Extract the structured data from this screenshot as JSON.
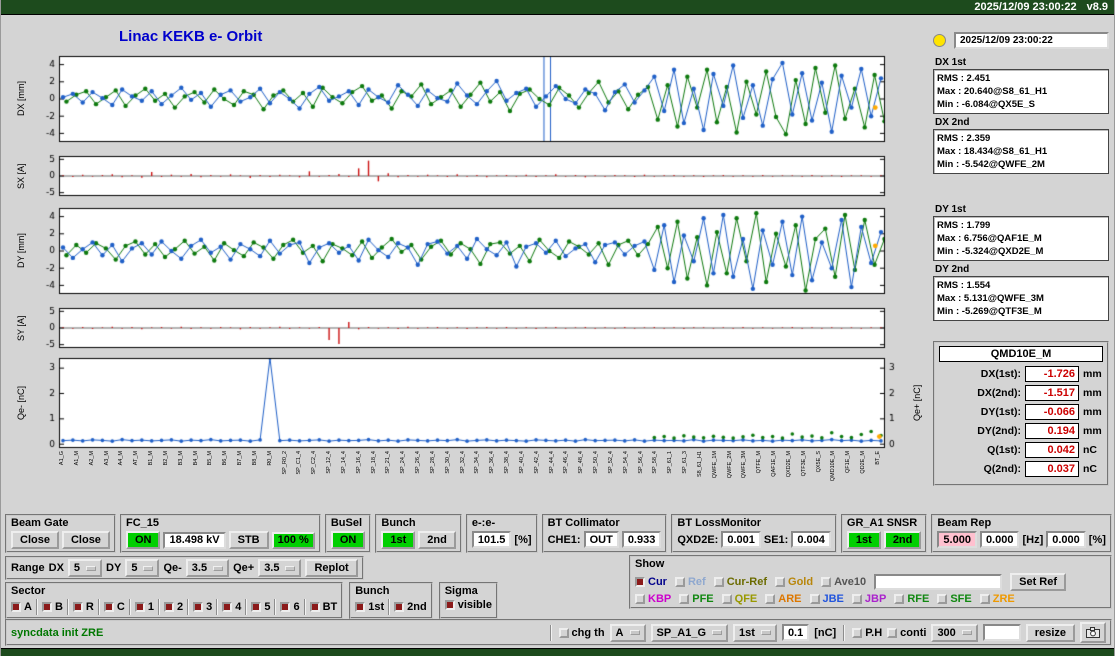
{
  "titlebar": {
    "datetime": "2025/12/09 23:00:22",
    "version": "v8.9"
  },
  "header": {
    "title": "Linac KEKB e- Orbit",
    "timestamp": "2025/12/09 23:00:22"
  },
  "stats": [
    {
      "label": "DX 1st",
      "lines": [
        "RMS : 2.451",
        "Max : 20.640@S8_61_H1",
        "Min : -6.084@QX5E_S"
      ]
    },
    {
      "label": "DX 2nd",
      "lines": [
        "RMS : 2.359",
        "Max : 18.434@S8_61_H1",
        "Min : -5.542@QWFE_2M"
      ]
    },
    {
      "label": "DY 1st",
      "lines": [
        "RMS : 1.799",
        "Max : 6.756@QAF1E_M",
        "Min : -5.324@QXD2E_M"
      ]
    },
    {
      "label": "DY 2nd",
      "lines": [
        "RMS : 1.554",
        "Max : 5.131@QWFE_3M",
        "Min : -5.269@QTF3E_M"
      ]
    }
  ],
  "monitor": {
    "title": "QMD10E_M",
    "rows": [
      {
        "label": "DX(1st):",
        "value": "-1.726",
        "unit": "mm"
      },
      {
        "label": "DX(2nd):",
        "value": "-1.517",
        "unit": "mm"
      },
      {
        "label": "DY(1st):",
        "value": "-0.066",
        "unit": "mm"
      },
      {
        "label": "DY(2nd):",
        "value": "0.194",
        "unit": "mm"
      },
      {
        "label": "Q(1st):",
        "value": "0.042",
        "unit": "nC"
      },
      {
        "label": "Q(2nd):",
        "value": "0.037",
        "unit": "nC"
      }
    ]
  },
  "controls": {
    "panels": {
      "beam_gate": {
        "label": "Beam Gate",
        "close1": "Close",
        "close2": "Close"
      },
      "fc15": {
        "label": "FC_15",
        "on": "ON",
        "kv": "18.498 kV",
        "stb": "STB",
        "duty": "100 %"
      },
      "busel": {
        "label": "BuSel",
        "on": "ON"
      },
      "bunch": {
        "label": "Bunch",
        "first": "1st",
        "second": "2nd"
      },
      "ee": {
        "label": "e-:e-",
        "value": "101.5",
        "unit": "[%]"
      },
      "bt_collimator": {
        "label": "BT Collimator",
        "che1_label": "CHE1:",
        "che1_value": "OUT",
        "value": "0.933"
      },
      "bt_lossmonitor": {
        "label": "BT LossMonitor",
        "qxd2e_label": "QXD2E:",
        "qxd2e_value": "0.001",
        "se1_label": "SE1:",
        "se1_value": "0.004"
      },
      "gr_a1": {
        "label": "GR_A1 SNSR",
        "first": "1st",
        "second": "2nd"
      },
      "beam_rep": {
        "label": "Beam Rep",
        "v1": "5.000",
        "v2": "0.000",
        "u1": "[Hz]",
        "v3": "0.000",
        "u2": "[%]"
      }
    },
    "range": {
      "label": "Range",
      "dx_label": "DX",
      "dx": "5",
      "dy_label": "DY",
      "dy": "5",
      "qem_label": "Qe-",
      "qem": "3.5",
      "qep_label": "Qe+",
      "qep": "3.5",
      "replot": "Replot"
    },
    "show": {
      "label": "Show",
      "set_ref": "Set Ref",
      "ref_input": "",
      "row1": [
        {
          "label": "Cur",
          "color": "#00008b",
          "checked": true
        },
        {
          "label": "Ref",
          "color": "#8fa8cf",
          "checked": false
        },
        {
          "label": "Cur-Ref",
          "color": "#6b6b00",
          "checked": false
        },
        {
          "label": "Gold",
          "color": "#b8860b",
          "checked": false
        },
        {
          "label": "Ave10",
          "color": "#555555",
          "checked": false
        }
      ],
      "row2": [
        {
          "label": "KBP",
          "color": "#cc00cc",
          "checked": false
        },
        {
          "label": "PFE",
          "color": "#118811",
          "checked": false
        },
        {
          "label": "QFE",
          "color": "#999900",
          "checked": false
        },
        {
          "label": "ARE",
          "color": "#dd7700",
          "checked": false
        },
        {
          "label": "JBE",
          "color": "#2255dd",
          "checked": false
        },
        {
          "label": "JBP",
          "color": "#aa22cc",
          "checked": false
        },
        {
          "label": "RFE",
          "color": "#118811",
          "checked": false
        },
        {
          "label": "SFE",
          "color": "#118811",
          "checked": false
        },
        {
          "label": "ZRE",
          "color": "#ee9900",
          "checked": false
        }
      ]
    },
    "sector": {
      "label": "Sector",
      "items": [
        "A",
        "B",
        "R",
        "C",
        "1",
        "2",
        "3",
        "4",
        "5",
        "6",
        "BT"
      ]
    },
    "bunch_select": {
      "label": "Bunch",
      "items": [
        "1st",
        "2nd"
      ]
    },
    "sigma": {
      "label": "Sigma",
      "items": [
        "visible"
      ]
    }
  },
  "statusbar": {
    "message": "syncdata init ZRE",
    "chg_th": "chg th",
    "mode": "A",
    "device": "SP_A1_G",
    "bunch": "1st",
    "threshold": "0.1",
    "threshold_unit": "[nC]",
    "ph": "P.H",
    "conti": "conti",
    "points": "300",
    "resize": "resize"
  },
  "stations": [
    "A1_G",
    "A1_M",
    "A2_M",
    "A3_M",
    "A4_M",
    "AT_M",
    "B1_M",
    "B2_M",
    "B3_M",
    "B4_M",
    "B5_M",
    "B6_M",
    "B7_M",
    "B8_M",
    "R0_M",
    "SP_R0_2",
    "SP_C1_4",
    "SP_C2_4",
    "SP_12_4",
    "SP_14_4",
    "SP_16_4",
    "SP_18_4",
    "SP_21_4",
    "SP_24_4",
    "SP_26_4",
    "SP_28_4",
    "SP_30_4",
    "SP_32_4",
    "SP_34_4",
    "SP_36_4",
    "SP_38_4",
    "SP_40_4",
    "SP_42_4",
    "SP_44_4",
    "SP_46_4",
    "SP_48_4",
    "SP_50_4",
    "SP_52_4",
    "SP_54_4",
    "SP_56_4",
    "SP_58_4",
    "SP_61_1",
    "SP_61_3",
    "S8_61_H1",
    "QWFE_1M",
    "QWFE_2M",
    "QWFE_3M",
    "QTFE_M",
    "QAF1E_M",
    "QXD2E_M",
    "QTF3E_M",
    "QX5E_S",
    "QMD10E_M",
    "QF1E_M",
    "QD2E_M",
    "BT_E"
  ],
  "chart_data": [
    {
      "id": "dx",
      "type": "orbit",
      "ylabel": "DX [mm]",
      "ylim": [
        -5,
        5
      ],
      "yticks": [
        4,
        2,
        0,
        -2,
        -4
      ],
      "spikes": [
        0.588,
        0.596
      ],
      "spike_color": "#2060c8",
      "marker": {
        "frac": 0.993,
        "value": -1.0,
        "color": "#ffaa00"
      },
      "series": [
        {
          "name": "2nd",
          "color": "#0e7a0e",
          "xoff": 0.35,
          "values": [
            -0.3,
            0.5,
            0.9,
            -0.6,
            0.2,
            1.0,
            -0.8,
            0.4,
            1.2,
            -0.2,
            0.6,
            -1.0,
            0.3,
            0.8,
            -0.4,
            1.1,
            0.0,
            -0.7,
            0.9,
            0.5,
            -1.2,
            0.4,
            1.0,
            -0.3,
            0.7,
            -0.9,
            1.3,
            0.2,
            -0.5,
            0.8,
            1.5,
            -0.2,
            0.4,
            -1.1,
            0.9,
            0.3,
            1.7,
            -0.6,
            0.2,
            1.0,
            -0.9,
            0.5,
            1.9,
            -0.3,
            0.8,
            -1.4,
            0.6,
            1.1,
            0.0,
            -0.7,
            1.3,
            0.4,
            -1.0,
            0.7,
            2.0,
            -0.4,
            0.9,
            -1.2,
            0.5,
            1.4,
            -2.4,
            1.6,
            -3.2,
            2.6,
            -1.0,
            3.4,
            -2.7,
            1.4,
            -3.9,
            2.0,
            -1.8,
            3.2,
            -2.1,
            -4.1,
            2.2,
            -2.9,
            3.6,
            -1.6,
            3.9,
            -2.3,
            1.2,
            -3.3,
            2.8,
            -2.6
          ]
        },
        {
          "name": "1st",
          "color": "#2060c8",
          "xoff": 0,
          "values": [
            0.2,
            0.6,
            -0.4,
            0.8,
            0.1,
            -0.7,
            1.1,
            0.3,
            -0.2,
            0.9,
            -0.6,
            0.4,
            1.3,
            -0.1,
            0.7,
            -0.9,
            0.5,
            1.0,
            -0.3,
            0.2,
            1.2,
            -0.5,
            0.8,
            0.0,
            -1.1,
            0.6,
            1.4,
            -0.2,
            0.3,
            0.9,
            -0.7,
            1.1,
            0.2,
            -0.4,
            1.6,
            0.5,
            -0.8,
            1.0,
            0.1,
            -0.3,
            1.8,
            0.4,
            -0.6,
            0.9,
            2.1,
            -0.2,
            0.7,
            1.2,
            -0.9,
            0.3,
            1.5,
            0.0,
            -0.5,
            1.1,
            0.6,
            -1.3,
            0.8,
            1.7,
            -0.4,
            1.0,
            2.6,
            -1.4,
            3.4,
            -2.8,
            1.2,
            -3.6,
            2.9,
            -0.8,
            3.9,
            -2.2,
            1.6,
            -3.1,
            2.3,
            4.2,
            -1.8,
            3.0,
            -2.5,
            1.9,
            -3.8,
            2.7,
            -1.0,
            3.5,
            -2.0,
            2.4
          ]
        }
      ]
    },
    {
      "id": "sx",
      "type": "stem",
      "ylabel": "SX [A]",
      "ylim": [
        -6,
        6
      ],
      "yticks": [
        5,
        0,
        -5
      ],
      "color": "#cc1111",
      "values": [
        0.2,
        -0.3,
        0.4,
        -0.2,
        0.3,
        0.5,
        -0.4,
        0.2,
        -0.5,
        1.2,
        -0.3,
        0.4,
        -0.2,
        0.6,
        -0.4,
        0.3,
        -0.2,
        0.5,
        0.2,
        -0.6,
        0.3,
        -0.3,
        0.4,
        0.2,
        -0.4,
        1.4,
        -0.2,
        0.3,
        0.6,
        -0.3,
        2.3,
        4.6,
        -1.6,
        0.8,
        -0.4,
        0.3,
        -0.2,
        0.4,
        0.2,
        -0.3,
        0.5,
        -0.2,
        0.3,
        -0.4,
        0.2,
        0.3,
        -0.2,
        0.4,
        -0.3,
        0.2,
        0.5,
        -0.2,
        0.3,
        -0.4,
        0.2,
        -0.2,
        0.3,
        0.2,
        -0.3,
        0.4,
        -0.2,
        0.2,
        0.3,
        -0.2,
        0.2,
        -0.3,
        0.2,
        0.3,
        -0.2,
        0.2,
        -0.2,
        0.3,
        -0.2,
        0.2,
        0.2,
        -0.2,
        0.3,
        -0.2,
        0.2,
        -0.3,
        0.2,
        0.2,
        -0.2,
        0.2
      ]
    },
    {
      "id": "dy",
      "type": "orbit",
      "ylabel": "DY [mm]",
      "ylim": [
        -5,
        5
      ],
      "yticks": [
        4,
        2,
        0,
        -2,
        -4
      ],
      "marker": {
        "frac": 0.993,
        "value": 0.6,
        "color": "#ffaa00"
      },
      "series": [
        {
          "name": "2nd",
          "color": "#0e7a0e",
          "xoff": 0.35,
          "values": [
            -0.5,
            0.7,
            -0.2,
            0.9,
            0.3,
            -1.0,
            0.6,
            1.1,
            -0.4,
            0.8,
            -0.7,
            0.2,
            1.2,
            -0.3,
            0.5,
            -1.1,
            0.9,
            0.1,
            -0.6,
            1.0,
            0.4,
            -0.9,
            0.7,
            1.3,
            -0.2,
            0.6,
            -1.2,
            0.8,
            0.3,
            -0.5,
            1.1,
            -0.8,
            0.4,
            1.4,
            -0.1,
            0.7,
            -1.0,
            0.5,
            1.2,
            -0.4,
            0.9,
            0.2,
            -1.5,
            0.8,
            1.0,
            -0.3,
            0.6,
            -1.2,
            1.3,
            0.0,
            -0.8,
            1.1,
            0.5,
            -0.4,
            0.9,
            -1.6,
            0.7,
            1.2,
            -0.5,
            0.8,
            2.8,
            -2.0,
            3.4,
            -3.2,
            1.6,
            -4.0,
            2.2,
            -2.6,
            3.8,
            -1.2,
            4.4,
            -3.6,
            2.0,
            -1.8,
            3.0,
            -4.6,
            1.4,
            2.6,
            -3.0,
            4.2,
            -2.2,
            3.6,
            -1.6,
            1.4
          ]
        },
        {
          "name": "1st",
          "color": "#2060c8",
          "xoff": 0,
          "values": [
            0.4,
            -0.8,
            0.2,
            1.0,
            -0.5,
            0.7,
            -1.2,
            0.3,
            0.9,
            -0.4,
            1.1,
            0.0,
            -0.9,
            0.6,
            1.3,
            -0.2,
            0.5,
            -1.0,
            0.8,
            0.2,
            -0.6,
            1.2,
            -0.3,
            0.7,
            1.0,
            -1.4,
            0.4,
            0.9,
            -0.2,
            0.6,
            -1.1,
            1.3,
            0.1,
            -0.7,
            0.9,
            0.4,
            -1.6,
            0.8,
            1.1,
            -0.3,
            0.6,
            -0.9,
            1.4,
            0.2,
            -0.5,
            1.0,
            -1.8,
            0.5,
            0.9,
            -0.2,
            1.2,
            -0.6,
            0.3,
            0.8,
            -1.3,
            0.7,
            1.0,
            -0.4,
            0.6,
            1.1,
            -2.2,
            3.0,
            -3.6,
            1.8,
            -1.2,
            3.8,
            -2.6,
            4.2,
            -3.0,
            1.4,
            -4.4,
            2.4,
            -1.6,
            3.4,
            -2.8,
            4.0,
            -3.4,
            1.0,
            -2.0,
            3.6,
            -4.2,
            2.8,
            -1.4,
            2.2
          ]
        }
      ]
    },
    {
      "id": "sy",
      "type": "stem",
      "ylabel": "SY [A]",
      "ylim": [
        -6,
        6
      ],
      "yticks": [
        5,
        0,
        -5
      ],
      "color": "#cc1111",
      "values": [
        0.2,
        -0.2,
        0.3,
        -0.3,
        0.2,
        0.4,
        -0.2,
        0.3,
        -0.4,
        0.2,
        0.3,
        -0.2,
        0.4,
        -0.3,
        0.2,
        -0.2,
        0.3,
        0.2,
        -0.4,
        0.3,
        -0.2,
        0.2,
        0.4,
        -0.3,
        0.2,
        -0.2,
        0.3,
        -3.6,
        -4.8,
        1.8,
        -0.4,
        0.3,
        -0.2,
        0.2,
        -0.3,
        0.4,
        -0.2,
        0.2,
        0.3,
        -0.2,
        0.2,
        -0.3,
        0.2,
        0.3,
        -0.2,
        0.3,
        -0.2,
        0.2,
        -0.3,
        0.2,
        0.3,
        -0.2,
        0.2,
        0.3,
        -0.2,
        0.2,
        -0.2,
        0.3,
        -0.2,
        0.2,
        0.3,
        -0.2,
        0.2,
        -0.3,
        0.2,
        0.2,
        -0.2,
        0.2,
        -0.2,
        0.3,
        -0.2,
        0.2,
        -0.2,
        0.2,
        0.3,
        -0.2,
        0.2,
        -0.2,
        0.2,
        -0.2,
        0.2,
        -0.2,
        0.2,
        0.2
      ]
    },
    {
      "id": "q",
      "type": "charge",
      "ylabel": "Qe- [nC]",
      "ylabel_right": "Qe+ [nC]",
      "ylim": [
        -0.15,
        3.4
      ],
      "yticks": [
        3,
        2,
        1,
        0
      ],
      "right_ticks": true,
      "marker": {
        "frac": 0.998,
        "value": 0.3,
        "color": "#ffaa00"
      },
      "blue": {
        "color": "#2060c8",
        "values": [
          0.14,
          0.16,
          0.13,
          0.17,
          0.15,
          0.12,
          0.18,
          0.14,
          0.16,
          0.13,
          0.15,
          0.17,
          0.12,
          0.16,
          0.14,
          0.18,
          0.13,
          0.15,
          0.16,
          0.12,
          0.17,
          3.4,
          0.14,
          0.16,
          0.13,
          0.15,
          0.17,
          0.12,
          0.16,
          0.14,
          0.15,
          0.18,
          0.13,
          0.16,
          0.12,
          0.17,
          0.15,
          0.13,
          0.16,
          0.14,
          0.18,
          0.12,
          0.15,
          0.17,
          0.13,
          0.16,
          0.14,
          0.12,
          0.17,
          0.15,
          0.13,
          0.16,
          0.12,
          0.18,
          0.14,
          0.15,
          0.16,
          0.13,
          0.17,
          0.12,
          0.16,
          0.14,
          0.15,
          0.13,
          0.18,
          0.12,
          0.16,
          0.15,
          0.14,
          0.17,
          0.13,
          0.15,
          0.12,
          0.16,
          0.14,
          0.17,
          0.13,
          0.15,
          0.18,
          0.14,
          0.16,
          0.12,
          0.15,
          0.13
        ]
      },
      "green": {
        "color": "#0e7a0e",
        "start": 60,
        "values": [
          0.26,
          0.3,
          0.24,
          0.33,
          0.28,
          0.25,
          0.31,
          0.27,
          0.24,
          0.29,
          0.35,
          0.26,
          0.3,
          0.24,
          0.4,
          0.28,
          0.32,
          0.25,
          0.45,
          0.3,
          0.26,
          0.38,
          0.5,
          0.34
        ]
      }
    }
  ]
}
